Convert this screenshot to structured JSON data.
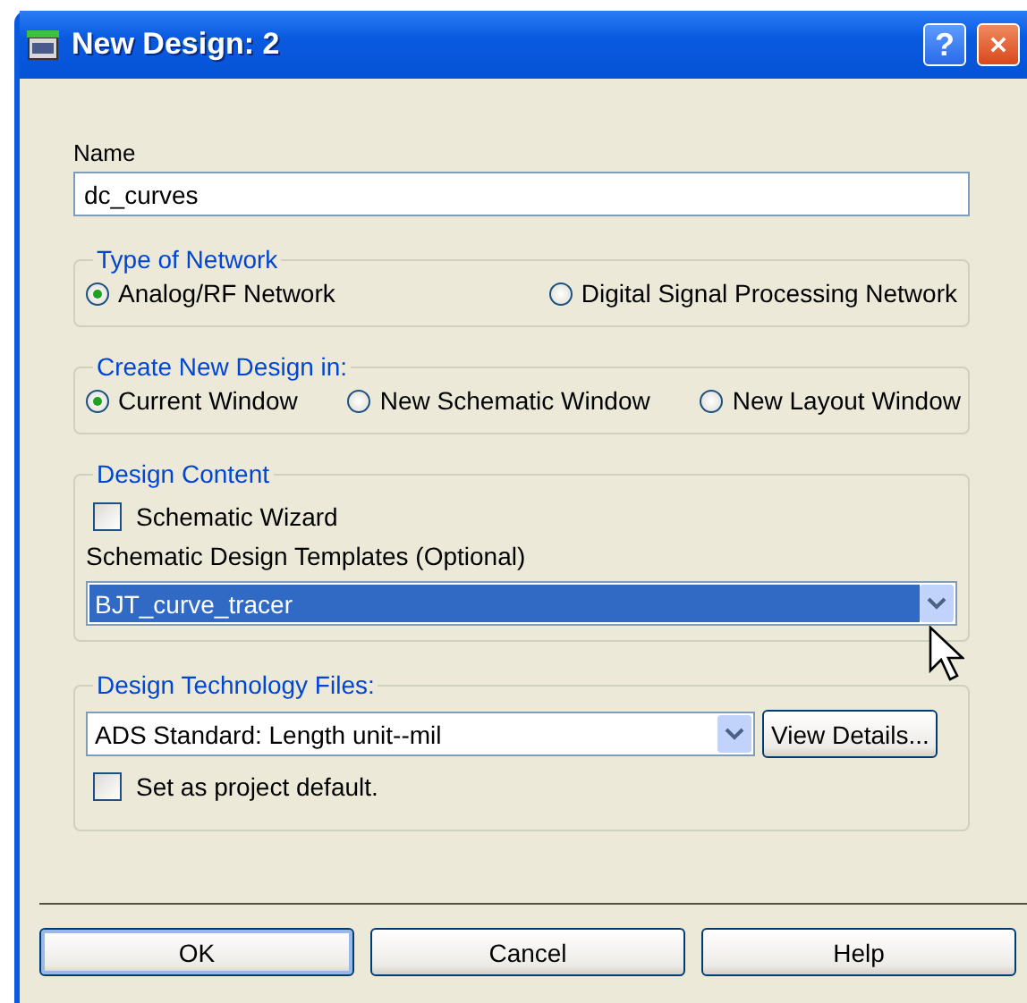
{
  "window": {
    "title": "New Design: 2",
    "help_button": "?"
  },
  "name_field": {
    "label": "Name",
    "value": "dc_curves"
  },
  "type_of_network": {
    "title": "Type of Network",
    "options": [
      {
        "label": "Analog/RF Network",
        "selected": true
      },
      {
        "label": "Digital Signal Processing Network",
        "selected": false
      }
    ]
  },
  "create_new_design_in": {
    "title": "Create New Design in:",
    "options": [
      {
        "label": "Current Window",
        "selected": true
      },
      {
        "label": "New Schematic Window",
        "selected": false
      },
      {
        "label": "New Layout Window",
        "selected": false
      }
    ]
  },
  "design_content": {
    "title": "Design Content",
    "wizard": {
      "label": "Schematic Wizard",
      "checked": false
    },
    "templates_label": "Schematic Design Templates (Optional)",
    "templates_dropdown": {
      "value": "BJT_curve_tracer",
      "focused": true
    }
  },
  "design_technology_files": {
    "title": "Design Technology Files:",
    "dropdown": {
      "value": "ADS Standard: Length unit--mil",
      "focused": false
    },
    "details_button": "View Details...",
    "project_default": {
      "label": "Set as project default.",
      "checked": false
    }
  },
  "buttons": [
    {
      "label": "OK",
      "default": true
    },
    {
      "label": "Cancel",
      "default": false
    },
    {
      "label": "Help",
      "default": false
    }
  ]
}
